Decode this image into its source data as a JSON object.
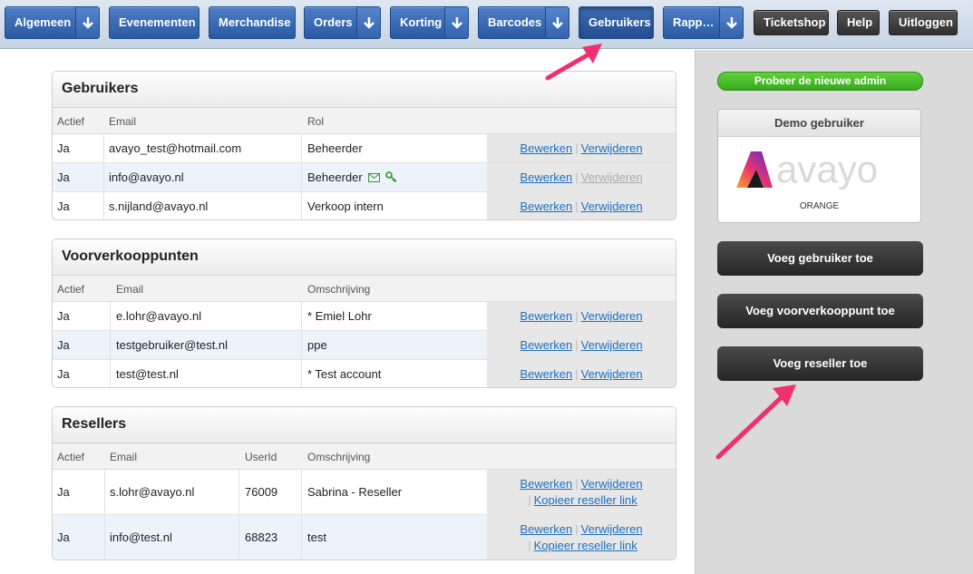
{
  "nav": {
    "algemeen": "Algemeen",
    "evenementen": "Evenementen",
    "merchandise": "Merchandise",
    "orders": "Orders",
    "korting": "Korting",
    "barcodes": "Barcodes",
    "gebruikers": "Gebruikers",
    "rapportages": "Rapp…",
    "ticketshop": "Ticketshop",
    "help": "Help",
    "uitloggen": "Uitloggen"
  },
  "actions": {
    "edit": "Bewerken",
    "delete": "Verwijderen",
    "copy_link": "Kopieer reseller link",
    "separator": "|"
  },
  "users": {
    "title": "Gebruikers",
    "headers": [
      "Actief",
      "Email",
      "Rol"
    ],
    "rows": [
      {
        "actief": "Ja",
        "email": "avayo_test@hotmail.com",
        "rol": "Beheerder"
      },
      {
        "actief": "Ja",
        "email": "info@avayo.nl",
        "rol": "Beheerder"
      },
      {
        "actief": "Ja",
        "email": "s.nijland@avayo.nl",
        "rol": "Verkoop intern"
      }
    ]
  },
  "pos": {
    "title": "Voorverkooppunten",
    "headers": [
      "Actief",
      "Email",
      "Omschrijving"
    ],
    "rows": [
      {
        "actief": "Ja",
        "email": "e.lohr@avayo.nl",
        "omschrijving": "* Emiel Lohr"
      },
      {
        "actief": "Ja",
        "email": "testgebruiker@test.nl",
        "omschrijving": "ppe"
      },
      {
        "actief": "Ja",
        "email": "test@test.nl",
        "omschrijving": "* Test account"
      }
    ]
  },
  "resellers": {
    "title": "Resellers",
    "headers": [
      "Actief",
      "Email",
      "UserId",
      "Omschrijving"
    ],
    "rows": [
      {
        "actief": "Ja",
        "email": "s.lohr@avayo.nl",
        "userid": "76009",
        "omschrijving": "Sabrina - Reseller"
      },
      {
        "actief": "Ja",
        "email": "info@test.nl",
        "userid": "68823",
        "omschrijving": "test"
      }
    ]
  },
  "sidebar": {
    "try_new_admin": "Probeer de nieuwe admin",
    "demo_title": "Demo gebruiker",
    "demo_logo_text": "avayo",
    "demo_caption": "ORANGE",
    "add_user": "Voeg gebruiker toe",
    "add_pos": "Voeg voorverkooppunt toe",
    "add_reseller": "Voeg reseller toe"
  },
  "colors": {
    "nav_blue": "#2f5fa8",
    "link_blue": "#1f6fbf",
    "green": "#43b526",
    "dark_button": "#303030",
    "annotation_pink": "#f0306e"
  }
}
